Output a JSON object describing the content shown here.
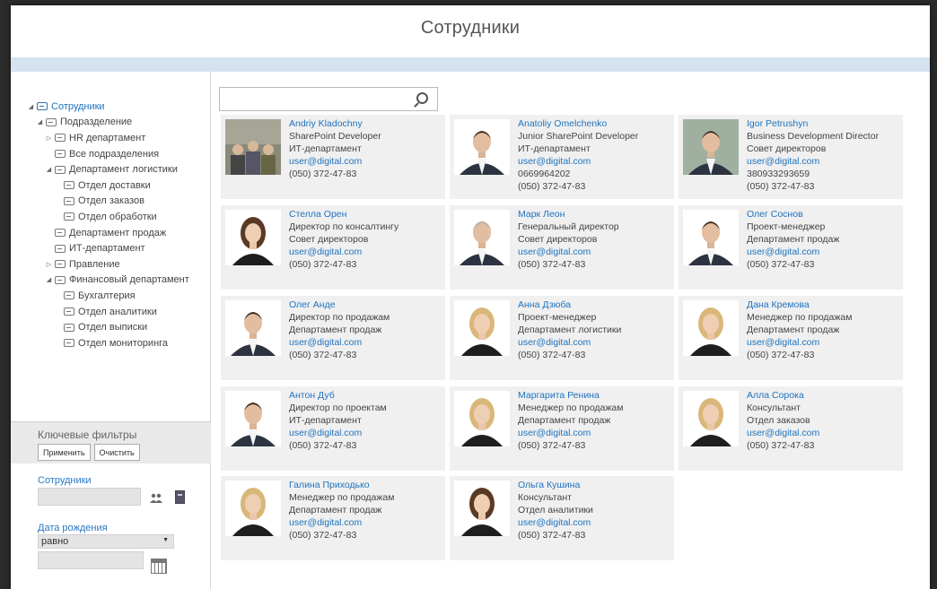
{
  "header": {
    "title": "Сотрудники"
  },
  "tree": [
    {
      "label": "Сотрудники",
      "level": 0,
      "toggle": "◢",
      "root": true
    },
    {
      "label": "Подразделение",
      "level": 1,
      "toggle": "◢"
    },
    {
      "label": "HR департамент",
      "level": 2,
      "toggle": "▷"
    },
    {
      "label": "Все подразделения",
      "level": 2,
      "toggle": ""
    },
    {
      "label": "Департамент логистики",
      "level": 2,
      "toggle": "◢"
    },
    {
      "label": "Отдел доставки",
      "level": 3,
      "toggle": ""
    },
    {
      "label": "Отдел заказов",
      "level": 3,
      "toggle": ""
    },
    {
      "label": "Отдел обработки",
      "level": 3,
      "toggle": ""
    },
    {
      "label": "Департамент продаж",
      "level": 2,
      "toggle": ""
    },
    {
      "label": "ИТ-департамент",
      "level": 2,
      "toggle": ""
    },
    {
      "label": "Правление",
      "level": 2,
      "toggle": "▷"
    },
    {
      "label": "Финансовый департамент",
      "level": 2,
      "toggle": "◢"
    },
    {
      "label": "Бухгалтерия",
      "level": 3,
      "toggle": ""
    },
    {
      "label": "Отдел аналитики",
      "level": 3,
      "toggle": ""
    },
    {
      "label": "Отдел выписки",
      "level": 3,
      "toggle": ""
    },
    {
      "label": "Отдел мониторинга",
      "level": 3,
      "toggle": ""
    }
  ],
  "key_filters": {
    "title": "Ключевые фильтры",
    "apply_label": "Применить",
    "clear_label": "Очистить",
    "employees_label": "Сотрудники",
    "birthdate_label": "Дата рождения",
    "birthdate_operator": "равно",
    "employees_icon": "people-picker-icon",
    "address_book_icon": "address-book-icon",
    "calendar_icon": "calendar-icon"
  },
  "search": {
    "icon": "search-icon"
  },
  "employees": [
    {
      "name": "Andriy Kladochny",
      "title": "SharePoint Developer",
      "dept": "ИТ-департамент",
      "email": "user@digital.com",
      "mobile": "",
      "phone": "(050) 372-47-83",
      "photo": "group"
    },
    {
      "name": "Anatoliy Omelchenko",
      "title": "Junior SharePoint Developer",
      "dept": "ИТ-департамент",
      "email": "user@digital.com",
      "mobile": "0669964202",
      "phone": "(050) 372-47-83",
      "photo": "man-glasses"
    },
    {
      "name": "Igor Petrushyn",
      "title": "Business Development Director",
      "dept": "Совет директоров",
      "email": "user@digital.com",
      "mobile": "380933293659",
      "phone": "(050) 372-47-83",
      "photo": "man-outdoor"
    },
    {
      "name": "Стелла Орен",
      "title": "Директор по консалтингу",
      "dept": "Совет директоров",
      "email": "user@digital.com",
      "mobile": "",
      "phone": "(050) 372-47-83",
      "photo": "woman-brunette"
    },
    {
      "name": "Марк Леон",
      "title": "Генеральный директор",
      "dept": "Совет директоров",
      "email": "user@digital.com",
      "mobile": "",
      "phone": "(050) 372-47-83",
      "photo": "man-grey"
    },
    {
      "name": "Олег Соснов",
      "title": "Проект-менеджер",
      "dept": "Департамент продаж",
      "email": "user@digital.com",
      "mobile": "",
      "phone": "(050) 372-47-83",
      "photo": "man-suit"
    },
    {
      "name": "Олег Анде",
      "title": "Директор по продажам",
      "dept": "Департамент продаж",
      "email": "user@digital.com",
      "mobile": "",
      "phone": "(050) 372-47-83",
      "photo": "man-glasses2"
    },
    {
      "name": "Анна Дзюба",
      "title": "Проект-менеджер",
      "dept": "Департамент логистики",
      "email": "user@digital.com",
      "mobile": "",
      "phone": "(050) 372-47-83",
      "photo": "woman-blonde"
    },
    {
      "name": "Дана Кремова",
      "title": "Менеджер по продажам",
      "dept": "Департамент продаж",
      "email": "user@digital.com",
      "mobile": "",
      "phone": "(050) 372-47-83",
      "photo": "woman-blonde-close"
    },
    {
      "name": "Антон Дуб",
      "title": "Директор по проектам",
      "dept": "ИТ-департамент",
      "email": "user@digital.com",
      "mobile": "",
      "phone": "(050) 372-47-83",
      "photo": "man-suit2"
    },
    {
      "name": "Маргарита Ренина",
      "title": "Менеджер по продажам",
      "dept": "Департамент продаж",
      "email": "user@digital.com",
      "mobile": "",
      "phone": "(050) 372-47-83",
      "photo": "woman-blonde2"
    },
    {
      "name": "Алла Сорока",
      "title": "Консультант",
      "dept": "Отдел заказов",
      "email": "user@digital.com",
      "mobile": "",
      "phone": "(050) 372-47-83",
      "photo": "woman-blonde3"
    },
    {
      "name": "Галина Приходько",
      "title": "Менеджер по продажам",
      "dept": "Департамент продаж",
      "email": "user@digital.com",
      "mobile": "",
      "phone": "(050) 372-47-83",
      "photo": "woman-blonde4"
    },
    {
      "name": "Ольга Кушина",
      "title": "Консультант",
      "dept": "Отдел аналитики",
      "email": "user@digital.com",
      "mobile": "",
      "phone": "(050) 372-47-83",
      "photo": "woman-dark"
    }
  ],
  "colors": {
    "link": "#1e73be",
    "card_bg": "#f0f0f0",
    "stripe": "#d5e2ef"
  }
}
